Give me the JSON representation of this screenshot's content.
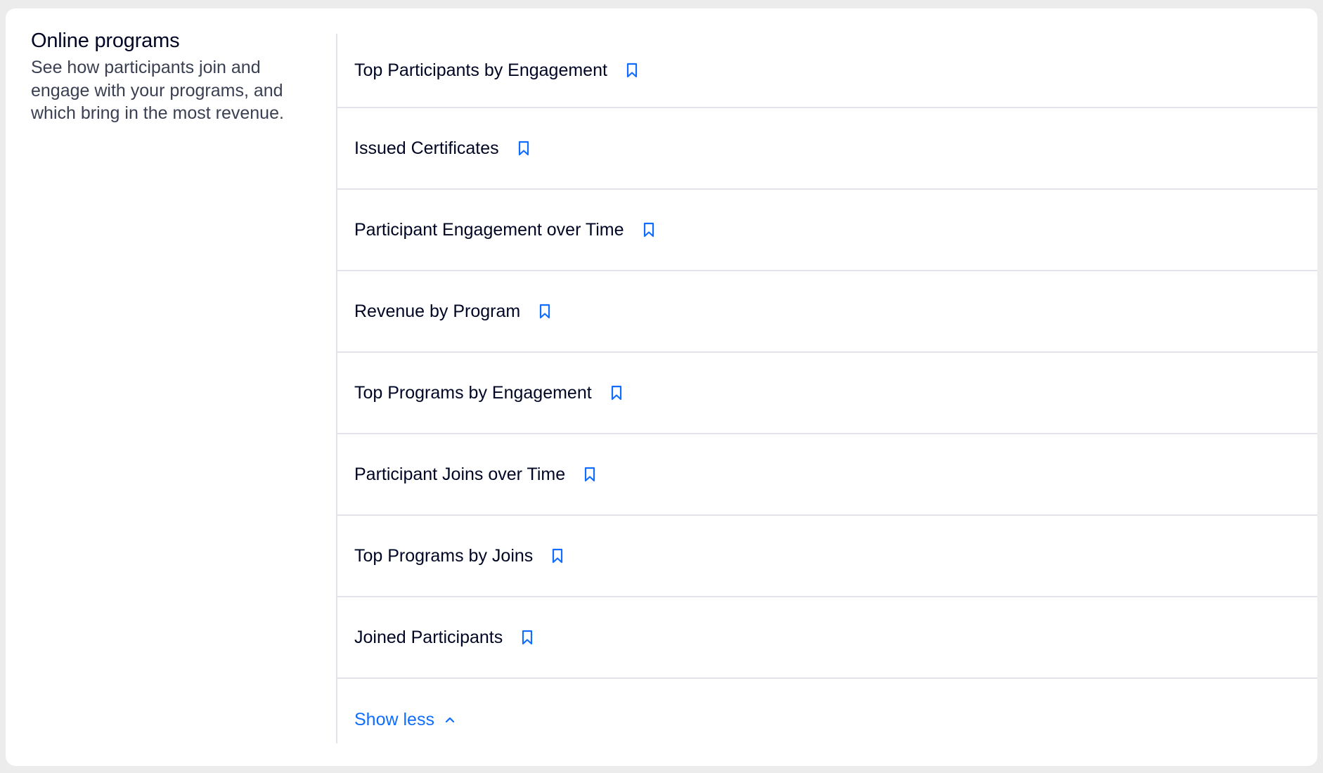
{
  "section": {
    "title": "Online programs",
    "description": "See how participants join and engage with your programs, and which bring in the most revenue."
  },
  "reports": [
    {
      "label": "Top Participants by Engagement",
      "icon": "bookmark-icon"
    },
    {
      "label": "Issued Certificates",
      "icon": "bookmark-icon"
    },
    {
      "label": "Participant Engagement over Time",
      "icon": "bookmark-icon"
    },
    {
      "label": "Revenue by Program",
      "icon": "bookmark-icon"
    },
    {
      "label": "Top Programs by Engagement",
      "icon": "bookmark-icon"
    },
    {
      "label": "Participant Joins over Time",
      "icon": "bookmark-icon"
    },
    {
      "label": "Top Programs by Joins",
      "icon": "bookmark-icon"
    },
    {
      "label": "Joined Participants",
      "icon": "bookmark-icon"
    }
  ],
  "toggle": {
    "label": "Show less",
    "icon": "chevron-up-icon"
  },
  "colors": {
    "accent": "#116DFF",
    "text": "#000624",
    "secondary_text": "#3A3F52",
    "divider": "#E2E4EA",
    "page_background": "#ECECEC",
    "card_background": "#FFFFFF"
  }
}
